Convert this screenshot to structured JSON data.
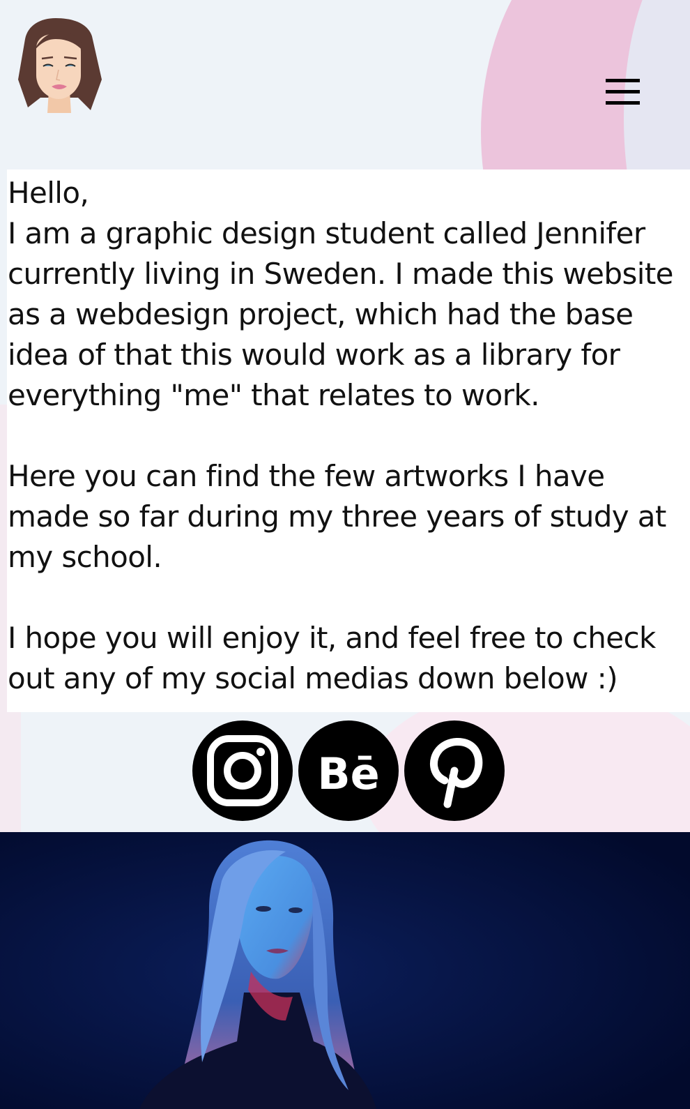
{
  "header": {
    "logo_alt": "Jennifer avatar logo",
    "menu_icon": "hamburger-menu-icon"
  },
  "intro": {
    "greeting": "Hello,",
    "paragraph1": "I am a graphic design student called Jennifer currently living in Sweden. I made this website as a webdesign project, which had the base idea of that this would work as a library for everything \"me\" that relates to work.",
    "paragraph2": "Here you can find the few artworks I have made so far during my three years of study at my school.",
    "paragraph3": "I hope you will enjoy it, and feel free to check out any of my social medias down below :)"
  },
  "social": {
    "links": [
      {
        "name": "Instagram",
        "icon": "instagram-icon"
      },
      {
        "name": "Behance",
        "icon": "behance-icon",
        "glyph": "Bē"
      },
      {
        "name": "Pinterest",
        "icon": "pinterest-icon"
      }
    ]
  },
  "photo": {
    "alt": "Portrait of Jennifer lit in blue and red light"
  },
  "colors": {
    "background": "#eef3f8",
    "accent_pink": "#ecc4dc",
    "text": "#111111",
    "icon_fill": "#000000",
    "photo_bg": "#020a2c",
    "photo_light_blue": "#3f8fe8",
    "photo_light_red": "#d8264a"
  }
}
